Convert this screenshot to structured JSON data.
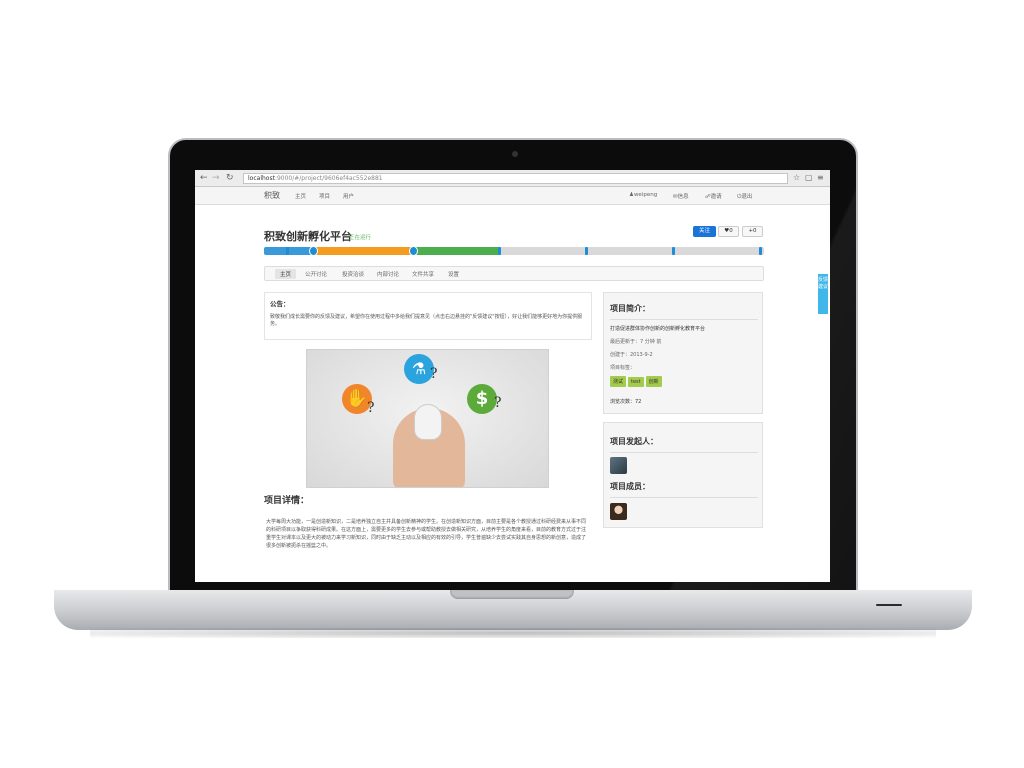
{
  "browser": {
    "url_host": "localhost",
    "url_path": ":9000/#/project/9606ef4ac552e881"
  },
  "nav": {
    "brand": "积致",
    "links": [
      "主页",
      "项目",
      "用户"
    ],
    "user": "weipeng",
    "messages": "信息",
    "invite": "邀请",
    "logout": "退出"
  },
  "project": {
    "title": "积致创新孵化平台",
    "status": "正在运行",
    "follow_label": "关注",
    "like_count": "0",
    "plus_count": "+0"
  },
  "tabs": [
    "主页",
    "公开讨论",
    "投资洽谈",
    "内部讨论",
    "文件共享",
    "设置"
  ],
  "notice": {
    "title": "公告：",
    "text": "致敬我们成长需要你的反馈及建议，希望你在使用过程中多给我们提意见（点击右边悬挂的\"反馈建议\"按钮），好让我们能够更好地为你提供服务。"
  },
  "detail": {
    "title": "项目详情：",
    "text": "大学每周大功能，一是创造新知识，二是培养独立自主并具备创新精神的学生。在创造新知识方面，目前主要是各个教授通过科研经费来从事不同的科研项目以争取获得科研成果。在这方面上，需要更多的学生去参与或帮助教授去做相关研究，从培养学生的角度来看，目前的教育方式过于注重学生对课本以及更大的被动力来学习新知识，同时由于缺乏主动以及相应的有效的引导，学生普遍缺少去尝试实践其自身思想的新创意，造成了很多创新被扼杀在摇篮之中。"
  },
  "intro": {
    "title": "项目简介：",
    "summary": "打造促进群体协作创新的创新孵化教育平台",
    "updated": "最后更新于：7 分钟 前",
    "created": "创建于：2013-9-2",
    "tags_label": "项目标签：",
    "tags": [
      "测试",
      "test",
      "创新"
    ],
    "visits": "浏览次数：72"
  },
  "people": {
    "founder_title": "项目发起人：",
    "members_title": "项目成员："
  },
  "feedback_label": "反馈建议",
  "colors": {
    "timeline_blue": "#3a9ad9",
    "timeline_orange": "#f39c1f",
    "timeline_green": "#4cae4c",
    "follow_button": "#1a73d9",
    "tag": "#a4cc4c",
    "feedback_tab": "#3fb7e8"
  }
}
